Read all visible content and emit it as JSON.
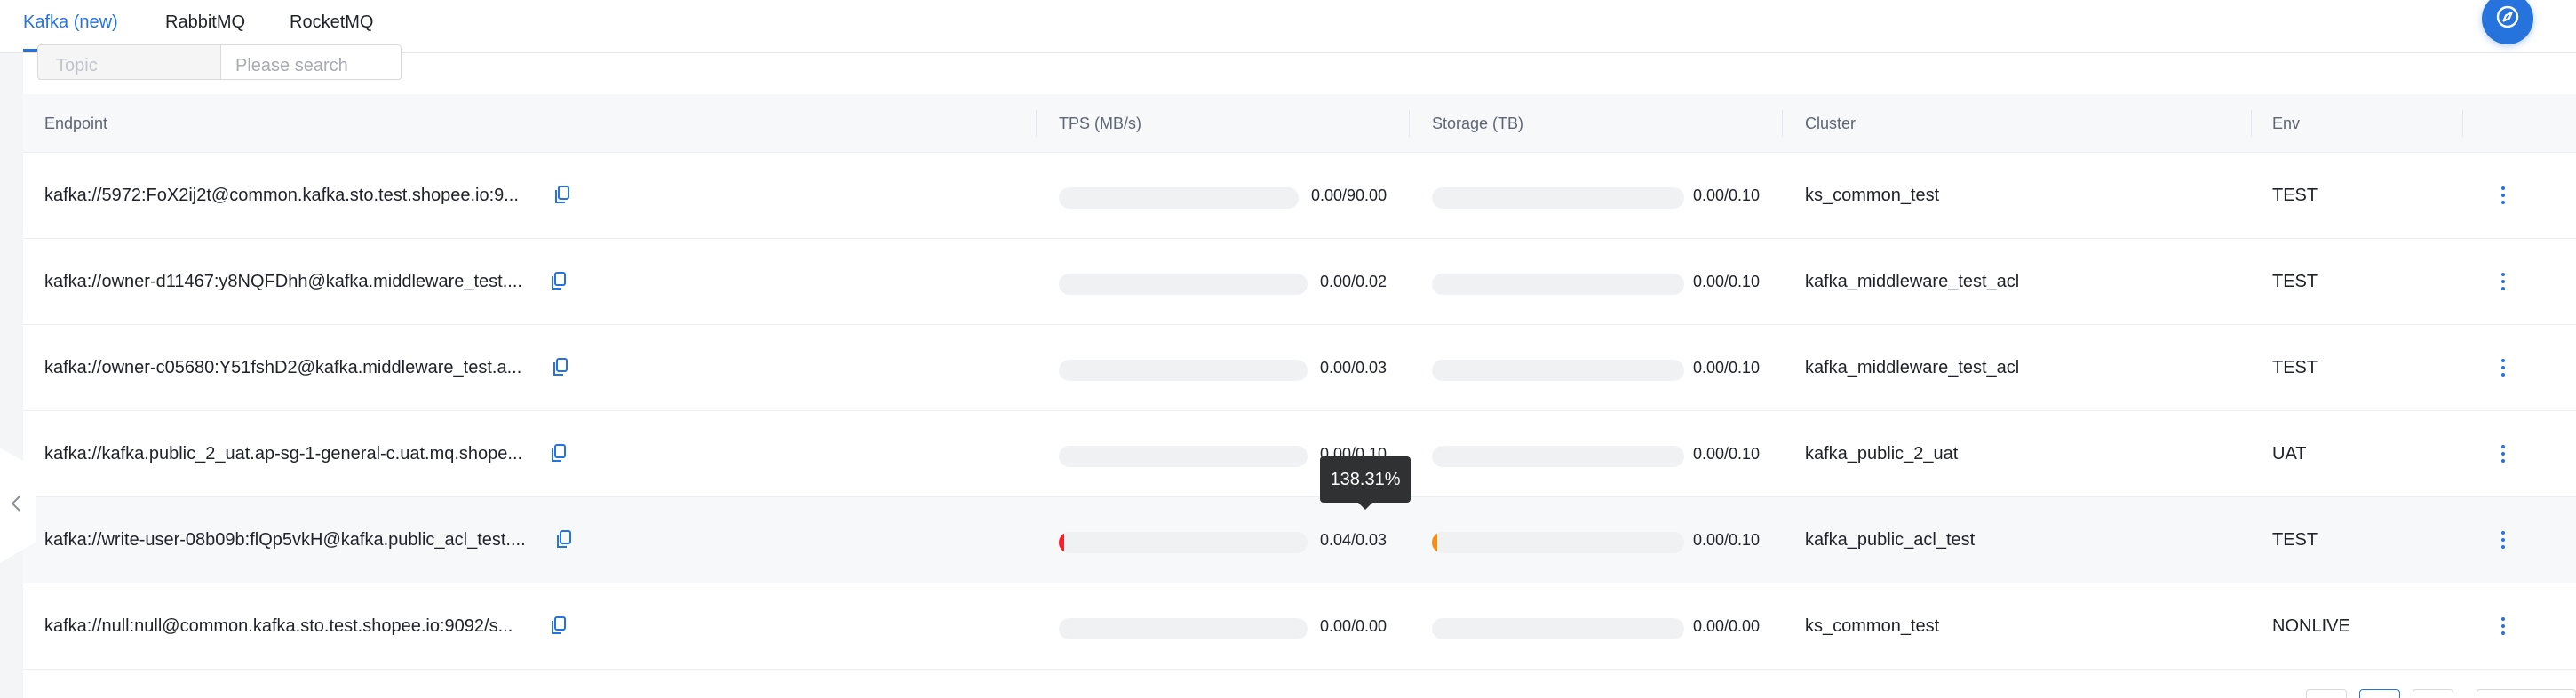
{
  "tabs": [
    {
      "label": "Kafka (new)",
      "active": true
    },
    {
      "label": "RabbitMQ",
      "active": false
    },
    {
      "label": "RocketMQ",
      "active": false
    }
  ],
  "fab": {
    "icon": "compass-icon"
  },
  "search": {
    "field_placeholder": "Topic",
    "input_placeholder": "Please search"
  },
  "table": {
    "headers": {
      "endpoint": "Endpoint",
      "tps": "TPS (MB/s)",
      "storage": "Storage (TB)",
      "cluster": "Cluster",
      "env": "Env"
    },
    "rows": [
      {
        "endpoint": "kafka://5972:FoX2ij2t@common.kafka.sto.test.shopee.io:9...",
        "tps": "0.00/90.00",
        "tps_fill": 0,
        "storage": "0.00/0.10",
        "storage_fill": 0,
        "cluster": "ks_common_test",
        "env": "TEST"
      },
      {
        "endpoint": "kafka://owner-d11467:y8NQFDhh@kafka.middleware_test....",
        "tps": "0.00/0.02",
        "tps_fill": 0,
        "storage": "0.00/0.10",
        "storage_fill": 0,
        "cluster": "kafka_middleware_test_acl",
        "env": "TEST"
      },
      {
        "endpoint": "kafka://owner-c05680:Y51fshD2@kafka.middleware_test.a...",
        "tps": "0.00/0.03",
        "tps_fill": 0,
        "storage": "0.00/0.10",
        "storage_fill": 0,
        "cluster": "kafka_middleware_test_acl",
        "env": "TEST"
      },
      {
        "endpoint": "kafka://kafka.public_2_uat.ap-sg-1-general-c.uat.mq.shope...",
        "tps": "0.00/0.10",
        "tps_fill": 0,
        "storage": "0.00/0.10",
        "storage_fill": 0,
        "cluster": "kafka_public_2_uat",
        "env": "UAT"
      },
      {
        "endpoint": "kafka://write-user-08b09b:flQp5vkH@kafka.public_acl_test....",
        "tps": "0.04/0.03",
        "tps_fill": 0.02,
        "storage": "0.00/0.10",
        "storage_fill": 0.01,
        "cluster": "kafka_public_acl_test",
        "env": "TEST"
      },
      {
        "endpoint": "kafka://null:null@common.kafka.sto.test.shopee.io:9092/s...",
        "tps": "0.00/0.00",
        "tps_fill": 0,
        "storage": "0.00/0.00",
        "storage_fill": 0,
        "cluster": "ks_common_test",
        "env": "NONLIVE"
      }
    ]
  },
  "tooltip": {
    "text": "138.31%"
  },
  "colors": {
    "accent": "#2673dd",
    "danger": "#f5222d",
    "warning": "#fa8c16"
  }
}
